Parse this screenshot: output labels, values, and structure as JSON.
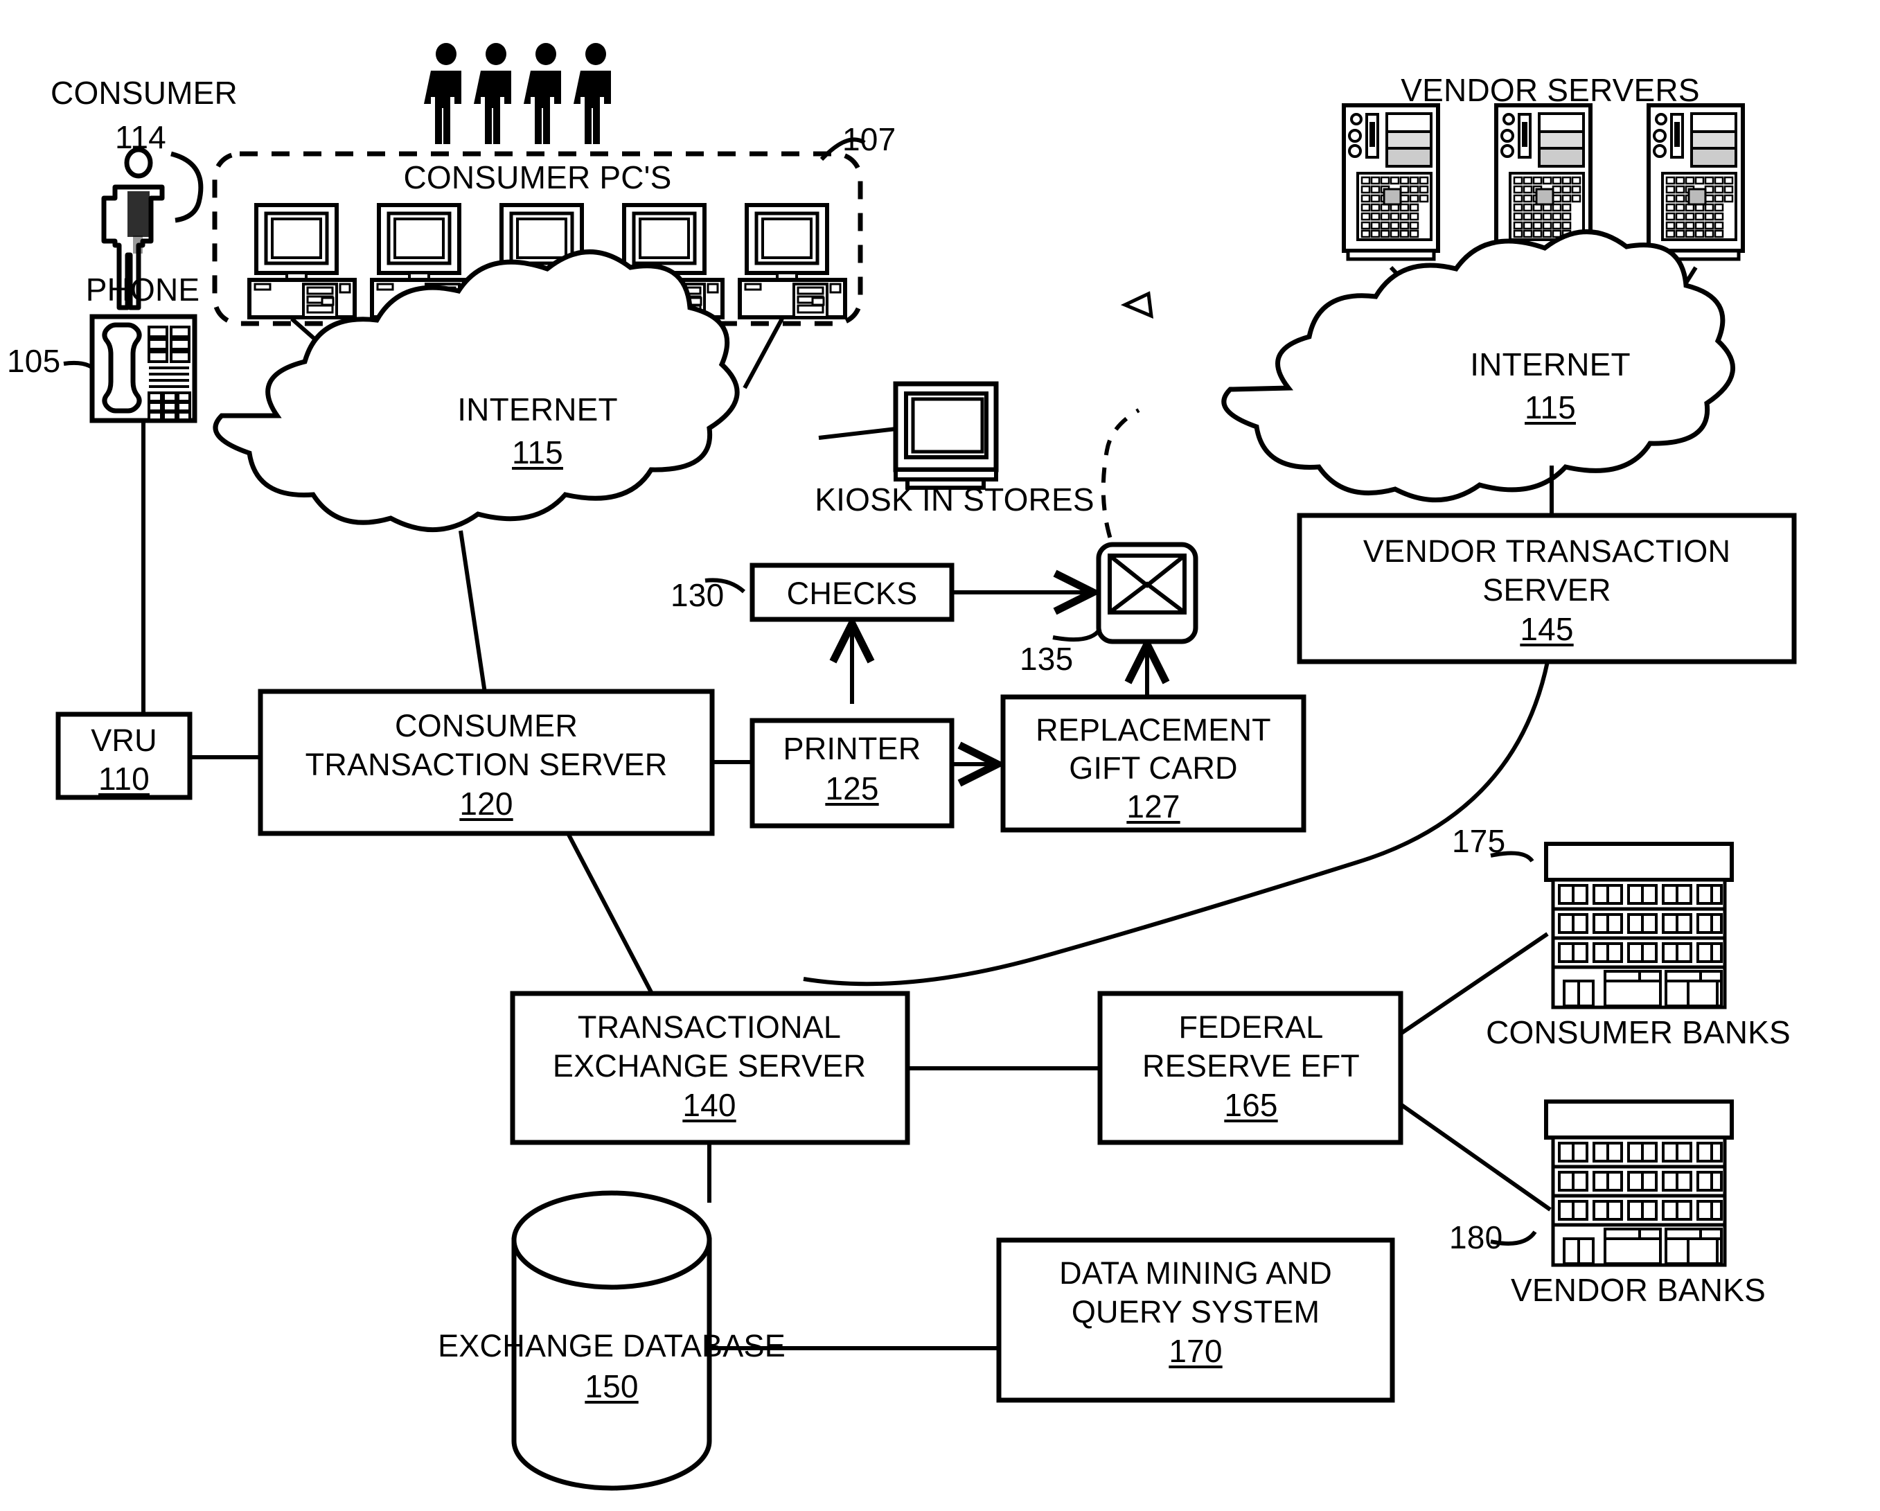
{
  "figure": {
    "type": "patent-system-diagram",
    "background": "#ffffff",
    "ink": "#000000"
  },
  "labels": {
    "consumer": "CONSUMER",
    "consumer_ref": "114",
    "phone": "PHONE",
    "phone_ref": "105",
    "consumer_pcs": "CONSUMER PC'S",
    "consumer_pcs_ref": "107",
    "internet_left": "INTERNET",
    "internet_left_ref": "115",
    "kiosk": "KIOSK IN STORES",
    "checks": "CHECKS",
    "checks_ref": "130",
    "envelope_ref": "135",
    "vru_title": "VRU",
    "vru_ref": "110",
    "cts_line1": "CONSUMER",
    "cts_line2": "TRANSACTION SERVER",
    "cts_ref": "120",
    "printer_title": "PRINTER",
    "printer_ref": "125",
    "gift_line1": "REPLACEMENT",
    "gift_line2": "GIFT CARD",
    "gift_ref": "127",
    "vendor_servers": "VENDOR SERVERS",
    "internet_right": "INTERNET",
    "internet_right_ref": "115",
    "vts_line1": "VENDOR TRANSACTION",
    "vts_line2": "SERVER",
    "vts_ref": "145",
    "tes_line1": "TRANSACTIONAL",
    "tes_line2": "EXCHANGE SERVER",
    "tes_ref": "140",
    "fed_line1": "FEDERAL",
    "fed_line2": "RESERVE EFT",
    "fed_ref": "165",
    "consumer_banks": "CONSUMER BANKS",
    "consumer_banks_ref": "175",
    "vendor_banks": "VENDOR BANKS",
    "vendor_banks_ref": "180",
    "exchange_db": "EXCHANGE DATABASE",
    "exchange_db_ref": "150",
    "dmq_line1": "DATA MINING AND",
    "dmq_line2": "QUERY SYSTEM",
    "dmq_ref": "170"
  },
  "icons": {
    "consumer_person": "person-icon",
    "people_group": "people-group-icon",
    "phone": "desk-phone-icon",
    "pc": "desktop-computer-icon",
    "cloud": "cloud-icon",
    "kiosk": "crt-monitor-icon",
    "envelope": "envelope-icon",
    "server_tower": "server-tower-icon",
    "bank": "bank-building-icon",
    "database": "database-cylinder-icon"
  },
  "nodes": [
    {
      "id": "105",
      "name": "phone",
      "label": "PHONE"
    },
    {
      "id": "107",
      "name": "consumer-pcs",
      "label": "CONSUMER PC'S"
    },
    {
      "id": "110",
      "name": "vru",
      "label": "VRU"
    },
    {
      "id": "114",
      "name": "consumer",
      "label": "CONSUMER"
    },
    {
      "id": "115",
      "name": "internet",
      "label": "INTERNET"
    },
    {
      "id": "120",
      "name": "consumer-transaction-server",
      "label": "CONSUMER TRANSACTION SERVER"
    },
    {
      "id": "125",
      "name": "printer",
      "label": "PRINTER"
    },
    {
      "id": "127",
      "name": "replacement-gift-card",
      "label": "REPLACEMENT GIFT CARD"
    },
    {
      "id": "130",
      "name": "checks",
      "label": "CHECKS"
    },
    {
      "id": "135",
      "name": "envelope",
      "label": "ENVELOPE"
    },
    {
      "id": "140",
      "name": "transactional-exchange-server",
      "label": "TRANSACTIONAL EXCHANGE SERVER"
    },
    {
      "id": "145",
      "name": "vendor-transaction-server",
      "label": "VENDOR TRANSACTION SERVER"
    },
    {
      "id": "150",
      "name": "exchange-database",
      "label": "EXCHANGE DATABASE"
    },
    {
      "id": "165",
      "name": "federal-reserve-eft",
      "label": "FEDERAL RESERVE EFT"
    },
    {
      "id": "170",
      "name": "data-mining-and-query-system",
      "label": "DATA MINING AND QUERY SYSTEM"
    },
    {
      "id": "175",
      "name": "consumer-banks",
      "label": "CONSUMER BANKS"
    },
    {
      "id": "180",
      "name": "vendor-banks",
      "label": "VENDOR BANKS"
    }
  ],
  "counts": {
    "consumer_pcs": 5,
    "people_in_group": 4,
    "vendor_servers": 3,
    "bank_buildings": 2
  }
}
